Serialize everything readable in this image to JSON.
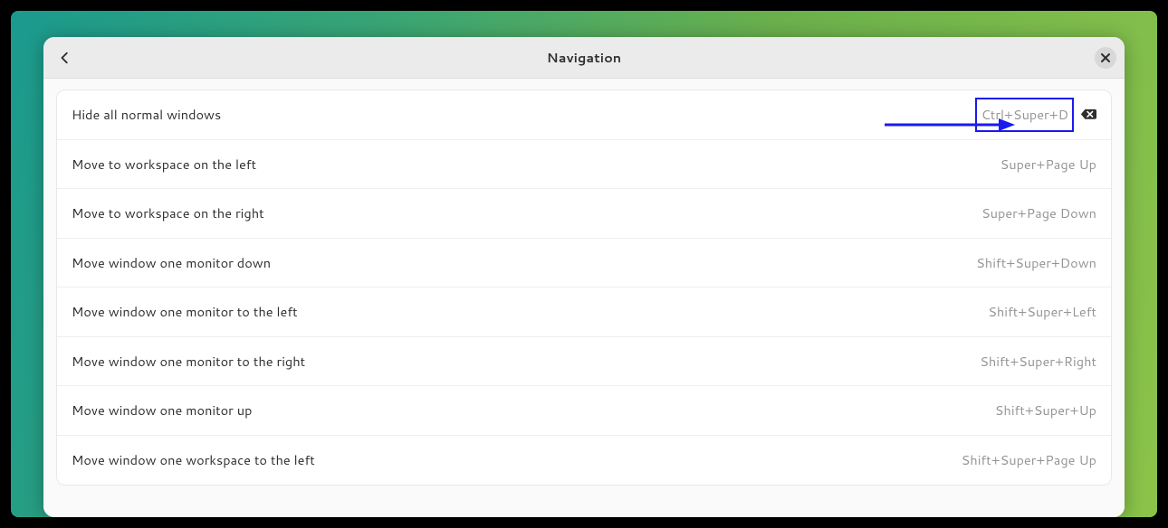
{
  "header": {
    "title": "Navigation"
  },
  "rows": [
    {
      "label": "Hide all normal windows",
      "shortcut": "Ctrl+Super+D",
      "highlighted": true,
      "clearable": true
    },
    {
      "label": "Move to workspace on the left",
      "shortcut": "Super+Page Up"
    },
    {
      "label": "Move to workspace on the right",
      "shortcut": "Super+Page Down"
    },
    {
      "label": "Move window one monitor down",
      "shortcut": "Shift+Super+Down"
    },
    {
      "label": "Move window one monitor to the left",
      "shortcut": "Shift+Super+Left"
    },
    {
      "label": "Move window one monitor to the right",
      "shortcut": "Shift+Super+Right"
    },
    {
      "label": "Move window one monitor up",
      "shortcut": "Shift+Super+Up"
    },
    {
      "label": "Move window one workspace to the left",
      "shortcut": "Shift+Super+Page Up"
    }
  ]
}
